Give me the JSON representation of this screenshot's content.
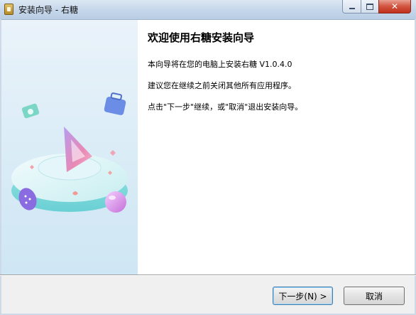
{
  "window": {
    "title": "安装向导 - 右糖",
    "minimize_label": "",
    "maximize_label": "",
    "close_label": "✕"
  },
  "content": {
    "heading": "欢迎使用右糖安装向导",
    "line1": "本向导将在您的电脑上安装右糖 V1.0.4.0",
    "line2": "建议您在继续之前关闭其他所有应用程序。",
    "line3": "点击\"下一步\"继续，或\"取消\"退出安装向导。"
  },
  "buttons": {
    "next": "下一步(N) >",
    "cancel": "取消"
  },
  "colors": {
    "accent_pink": "#e77aa0",
    "accent_teal": "#5dc5c4",
    "accent_purple": "#7a5bd2"
  }
}
